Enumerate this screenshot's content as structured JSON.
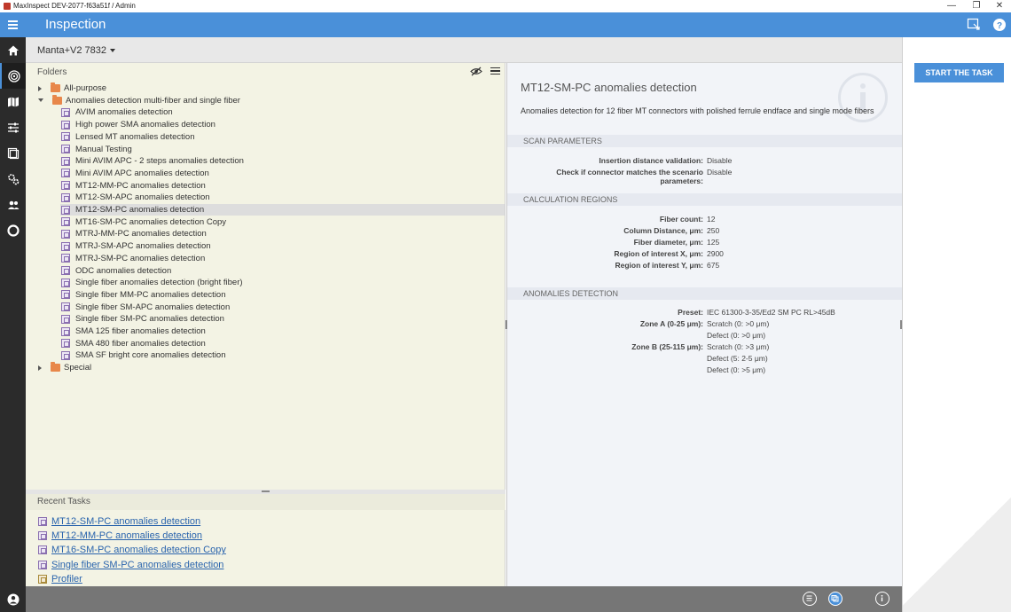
{
  "window": {
    "title": "MaxInspect DEV-2077-f63a51f / Admin",
    "controls": [
      "—",
      "❐",
      "✕"
    ]
  },
  "appbar": {
    "title": "Inspection"
  },
  "device": {
    "name": "Manta+V2 7832"
  },
  "folders": {
    "label": "Folders",
    "tree": [
      {
        "type": "folder",
        "state": "collapsed",
        "label": "All-purpose",
        "level": 0
      },
      {
        "type": "folder",
        "state": "expanded",
        "label": "Anomalies detection multi-fiber and single fiber",
        "level": 0
      },
      {
        "type": "task",
        "label": "AVIM anomalies detection",
        "level": 1
      },
      {
        "type": "task",
        "label": "High power SMA anomalies detection",
        "level": 1
      },
      {
        "type": "task",
        "label": "Lensed MT anomalies detection",
        "level": 1
      },
      {
        "type": "task",
        "label": "Manual Testing",
        "level": 1
      },
      {
        "type": "task",
        "label": "Mini AVIM APC - 2 steps anomalies detection",
        "level": 1
      },
      {
        "type": "task",
        "label": "Mini AVIM APC anomalies detection",
        "level": 1
      },
      {
        "type": "task",
        "label": "MT12-MM-PC anomalies detection",
        "level": 1
      },
      {
        "type": "task",
        "label": "MT12-SM-APC anomalies detection",
        "level": 1
      },
      {
        "type": "task",
        "label": "MT12-SM-PC anomalies detection",
        "level": 1,
        "selected": true
      },
      {
        "type": "task",
        "label": "MT16-SM-PC anomalies detection Copy",
        "level": 1
      },
      {
        "type": "task",
        "label": "MTRJ-MM-PC anomalies detection",
        "level": 1
      },
      {
        "type": "task",
        "label": "MTRJ-SM-APC anomalies detection",
        "level": 1
      },
      {
        "type": "task",
        "label": "MTRJ-SM-PC anomalies detection",
        "level": 1
      },
      {
        "type": "task",
        "label": "ODC anomalies detection",
        "level": 1
      },
      {
        "type": "task",
        "label": "Single fiber anomalies detection (bright fiber)",
        "level": 1
      },
      {
        "type": "task",
        "label": "Single fiber MM-PC anomalies detection",
        "level": 1
      },
      {
        "type": "task",
        "label": "Single fiber SM-APC anomalies detection",
        "level": 1
      },
      {
        "type": "task",
        "label": "Single fiber SM-PC anomalies detection",
        "level": 1
      },
      {
        "type": "task",
        "label": "SMA 125 fiber anomalies detection",
        "level": 1
      },
      {
        "type": "task",
        "label": "SMA 480 fiber anomalies detection",
        "level": 1
      },
      {
        "type": "task",
        "label": "SMA SF bright core anomalies detection",
        "level": 1
      },
      {
        "type": "folder",
        "state": "collapsed",
        "label": "Special",
        "level": 0
      }
    ]
  },
  "recent": {
    "label": "Recent Tasks",
    "items": [
      {
        "label": "MT12-SM-PC anomalies detection",
        "kind": "task"
      },
      {
        "label": "MT12-MM-PC anomalies detection",
        "kind": "task"
      },
      {
        "label": "MT16-SM-PC anomalies detection Copy",
        "kind": "task"
      },
      {
        "label": "Single fiber SM-PC anomalies detection",
        "kind": "task"
      },
      {
        "label": "Profiler",
        "kind": "profiler"
      }
    ]
  },
  "details": {
    "title": "MT12-SM-PC anomalies detection",
    "description": "Anomalies detection for 12 fiber MT connectors with polished ferrule endface and single mode fibers",
    "sections": {
      "scan": {
        "heading": "SCAN PARAMETERS",
        "params": [
          {
            "label": "Insertion distance validation:",
            "value": "Disable"
          },
          {
            "label": "Check if connector matches the scenario parameters:",
            "value": "Disable"
          }
        ]
      },
      "calc": {
        "heading": "CALCULATION REGIONS",
        "params": [
          {
            "label": "Fiber count:",
            "value": "12"
          },
          {
            "label": "Column Distance, μm:",
            "value": "250"
          },
          {
            "label": "Fiber diameter, μm:",
            "value": "125"
          },
          {
            "label": "Region of interest X, μm:",
            "value": "2900"
          },
          {
            "label": "Region of interest Y, μm:",
            "value": "675"
          }
        ]
      },
      "anomalies": {
        "heading": "ANOMALIES DETECTION",
        "preset_label": "Preset:",
        "preset_value": "IEC 61300-3-35/Ed2 SM PC RL>45dB",
        "zone_a_label": "Zone A (0-25 μm):",
        "zone_a_values": [
          "Scratch (0: >0 μm)",
          "Defect (0: >0 μm)"
        ],
        "zone_b_label": "Zone B (25-115 μm):",
        "zone_b_values": [
          "Scratch (0: >3 μm)",
          "Defect (5: 2-5 μm)",
          "Defect (0: >5 μm)"
        ]
      }
    }
  },
  "actions": {
    "start_label": "START THE TASK"
  },
  "colors": {
    "accent": "#4a90d9",
    "nav_bg": "#2b2b2b",
    "panel_bg": "#f3f3e4",
    "link": "#2a64ad"
  }
}
